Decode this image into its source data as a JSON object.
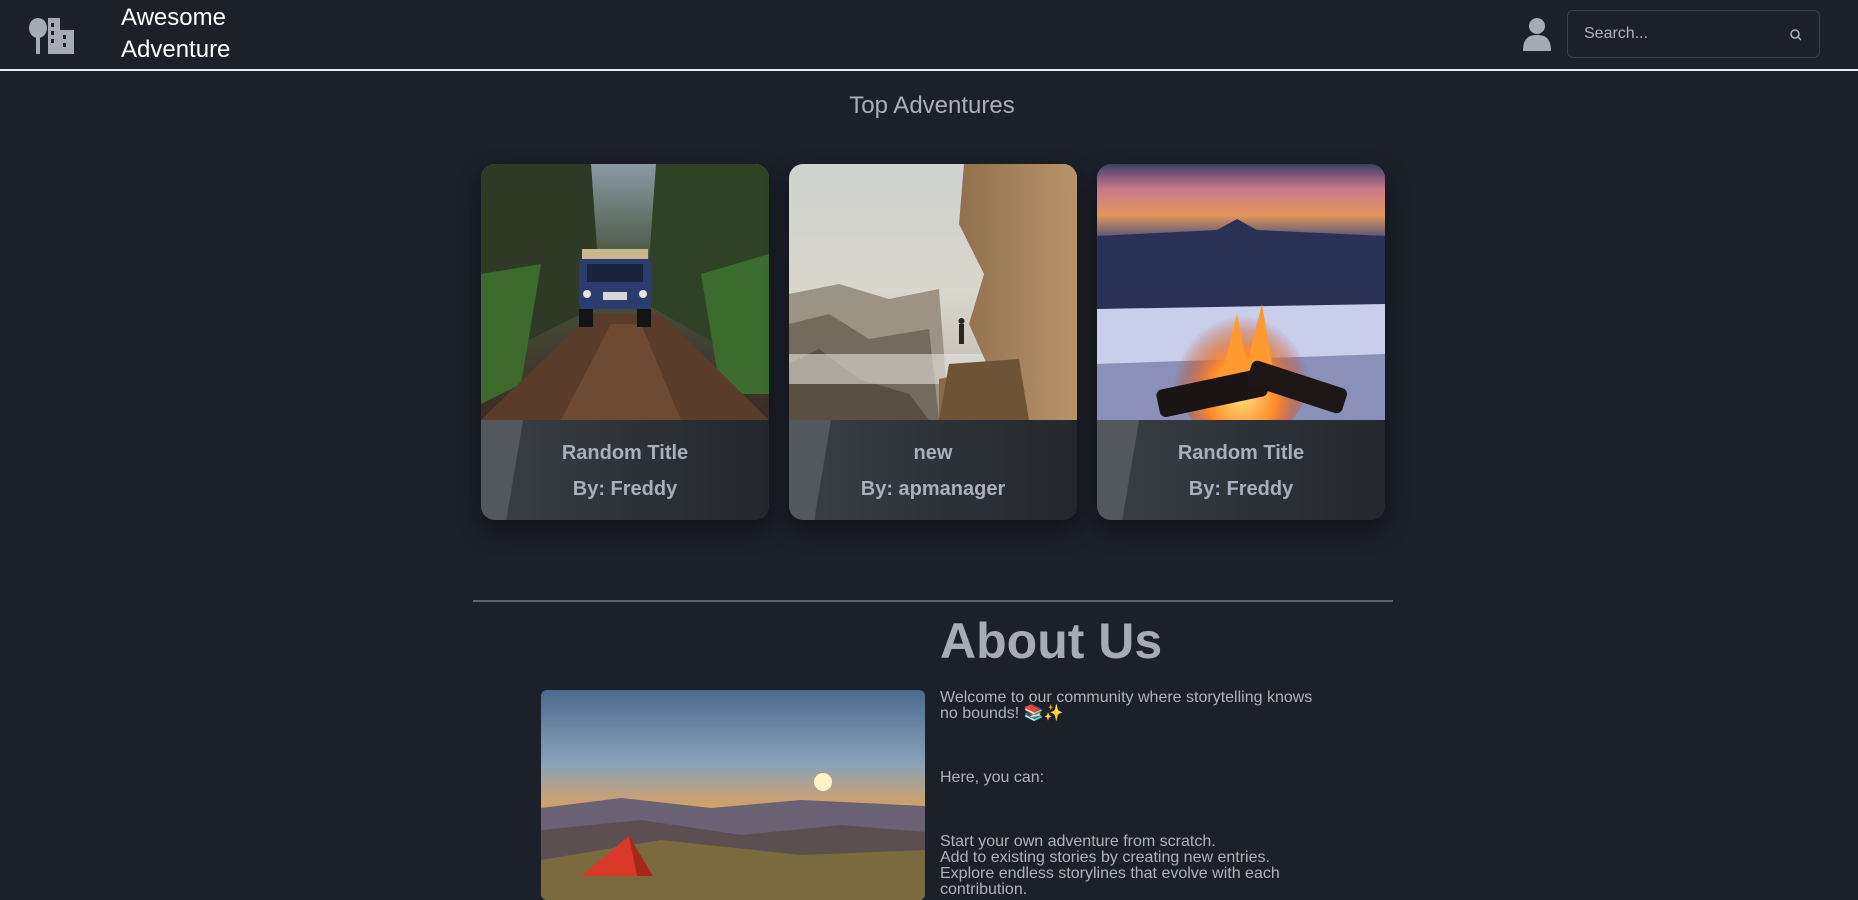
{
  "header": {
    "brand_line1": "Awesome",
    "brand_line2": "Adventure",
    "search_placeholder": "Search..."
  },
  "top_adventures": {
    "title": "Top Adventures",
    "cards": [
      {
        "title": "Random Title",
        "author": "By: Freddy",
        "image": "jeep-in-forest"
      },
      {
        "title": "new",
        "author": "By: apmanager",
        "image": "cliff-over-misty-valley"
      },
      {
        "title": "Random Title",
        "author": "By: Freddy",
        "image": "campfire-at-dusk"
      }
    ]
  },
  "about": {
    "title": "About Us",
    "intro": "Welcome to our community where storytelling knows no bounds! 📚✨",
    "lead": "Here, you can:",
    "items": [
      "Start your own adventure from scratch.",
      "Add to existing stories by creating new entries.",
      "Explore endless storylines that evolve with each contribution."
    ],
    "image": "tent-at-sunset"
  },
  "colors": {
    "background": "#1c2029",
    "text": "#a6abb6",
    "header_border": "#e8e9ec"
  }
}
